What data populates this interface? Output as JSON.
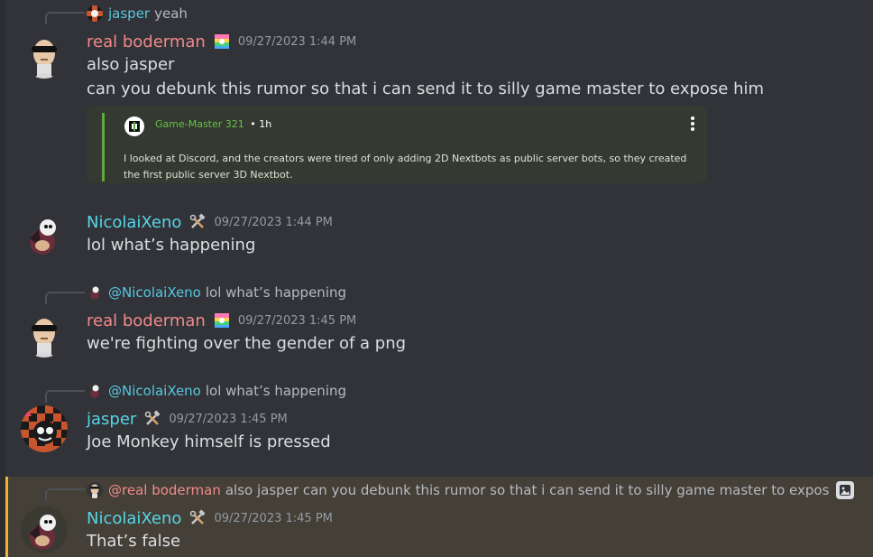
{
  "messages": [
    {
      "reply": {
        "author": "jasper",
        "text": "yeah"
      },
      "author": "real boderman",
      "timestamp": "09/27/2023 1:44 PM",
      "lines": [
        "also jasper",
        "can you debunk this rumor so that i can send it to silly game master to expose him"
      ],
      "embed": {
        "author": "Game-Master 321",
        "separator": "•",
        "time": "1h",
        "body": "I looked at Discord, and the creators were tired of only adding 2D Nextbots as public server bots, so they created the first public server 3D Nextbot."
      }
    },
    {
      "author": "NicolaiXeno",
      "timestamp": "09/27/2023 1:44 PM",
      "lines": [
        "lol what’s happening"
      ]
    },
    {
      "reply": {
        "author": "@NicolaiXeno",
        "text": "lol what’s happening"
      },
      "author": "real boderman",
      "timestamp": "09/27/2023 1:45 PM",
      "lines": [
        "we're fighting over the gender of a png"
      ]
    },
    {
      "reply": {
        "author": "@NicolaiXeno",
        "text": "lol what’s happening"
      },
      "author": "jasper",
      "timestamp": "09/27/2023 1:45 PM",
      "lines": [
        "Joe Monkey himself is pressed"
      ]
    },
    {
      "reply": {
        "author": "@real boderman",
        "text": "also jasper can you debunk this rumor so that i can send it to silly game master to expos"
      },
      "author": "NicolaiXeno",
      "timestamp": "09/27/2023 1:45 PM",
      "lines": [
        "That’s false"
      ],
      "mentioned": true
    }
  ],
  "colors": {
    "background": "#313338",
    "real_boderman": "#f08a8a",
    "nicolaixeno": "#56d6e6",
    "jasper": "#56d6e6",
    "mention_highlight": "#f0b232",
    "embed_accent": "#5cab3b"
  },
  "icons": {
    "boderman_badge": "rainbow-badge-icon",
    "tools_badge": "hammer-wrench-icon",
    "attachment": "image-icon"
  }
}
